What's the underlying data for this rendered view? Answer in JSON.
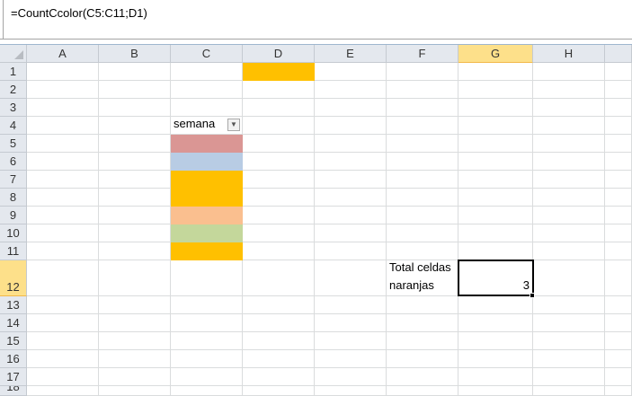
{
  "formula_bar": {
    "formula": "=CountCcolor(C5:C11;D1)"
  },
  "columns": [
    "A",
    "B",
    "C",
    "D",
    "E",
    "F",
    "G",
    "H",
    ""
  ],
  "rows": [
    "1",
    "2",
    "3",
    "4",
    "5",
    "6",
    "7",
    "8",
    "9",
    "10",
    "11",
    "12",
    "13",
    "14",
    "15",
    "16",
    "17",
    "18"
  ],
  "selected_column": "G",
  "selected_row": "12",
  "cells": {
    "C4": {
      "text": "semana",
      "filter": true
    },
    "F12": {
      "text": "Total celdas\nnaranjas"
    },
    "G12": {
      "text": "3",
      "align": "right"
    }
  },
  "fills": {
    "D1": "#ffc000",
    "C5": "#da9694",
    "C6": "#b8cce4",
    "C7": "#ffc000",
    "C8": "#ffc000",
    "C9": "#fabf8f",
    "C10": "#c4d79b",
    "C11": "#ffc000"
  },
  "icons": {
    "filter": "dropdown-arrow-icon"
  }
}
